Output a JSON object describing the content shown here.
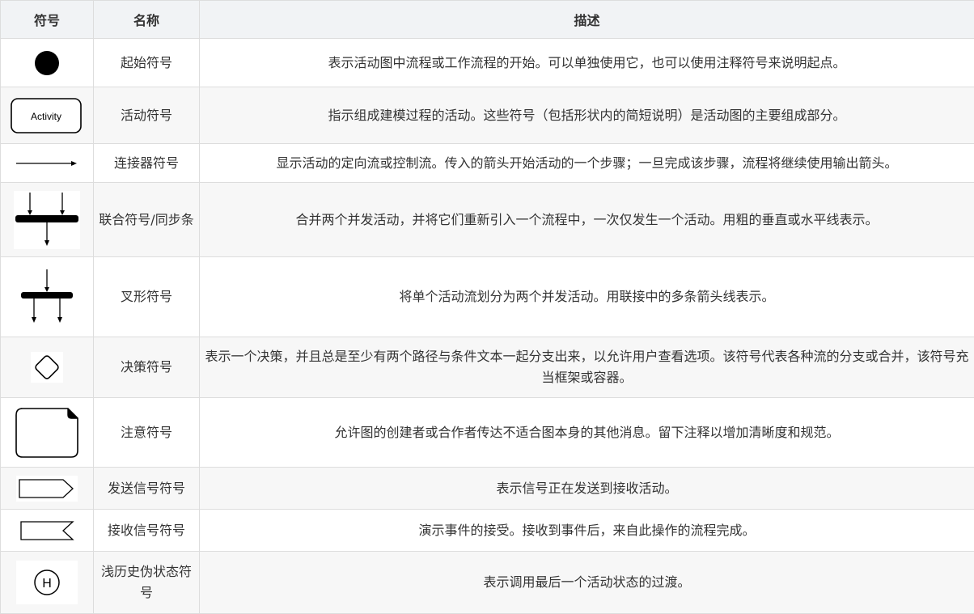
{
  "table": {
    "headers": [
      "符号",
      "名称",
      "描述"
    ],
    "rows": [
      {
        "icon": "start-circle-icon",
        "name": "起始符号",
        "desc": "表示活动图中流程或工作流程的开始。可以单独使用它，也可以使用注释符号来说明起点。"
      },
      {
        "icon": "activity-box-icon",
        "icon_text": "Activity",
        "name": "活动符号",
        "desc": "指示组成建模过程的活动。这些符号（包括形状内的简短说明）是活动图的主要组成部分。"
      },
      {
        "icon": "arrow-connector-icon",
        "name": "连接器符号",
        "desc": "显示活动的定向流或控制流。传入的箭头开始活动的一个步骤；一旦完成该步骤，流程将继续使用输出箭头。"
      },
      {
        "icon": "join-bar-icon",
        "name": "联合符号/同步条",
        "desc": "合并两个并发活动，并将它们重新引入一个流程中，一次仅发生一个活动。用粗的垂直或水平线表示。"
      },
      {
        "icon": "fork-bar-icon",
        "name": "叉形符号",
        "desc": "将单个活动流划分为两个并发活动。用联接中的多条箭头线表示。"
      },
      {
        "icon": "decision-diamond-icon",
        "name": "决策符号",
        "desc": "表示一个决策，并且总是至少有两个路径与条件文本一起分支出来，以允许用户查看选项。该符号代表各种流的分支或合并，该符号充当框架或容器。"
      },
      {
        "icon": "note-icon",
        "name": "注意符号",
        "desc": "允许图的创建者或合作者传达不适合图本身的其他消息。留下注释以增加清晰度和规范。"
      },
      {
        "icon": "send-signal-icon",
        "name": "发送信号符号",
        "desc": "表示信号正在发送到接收活动。"
      },
      {
        "icon": "receive-signal-icon",
        "name": "接收信号符号",
        "desc": "演示事件的接受。接收到事件后，来自此操作的流程完成。"
      },
      {
        "icon": "shallow-history-icon",
        "icon_text": "H",
        "name": "浅历史伪状态符号",
        "desc": "表示调用最后一个活动状态的过渡。"
      }
    ]
  },
  "colors": {
    "border": "#dddddd",
    "header_bg": "#f1f3f5",
    "alt_row_bg": "#f7f7f7",
    "symbol": "#000000"
  }
}
